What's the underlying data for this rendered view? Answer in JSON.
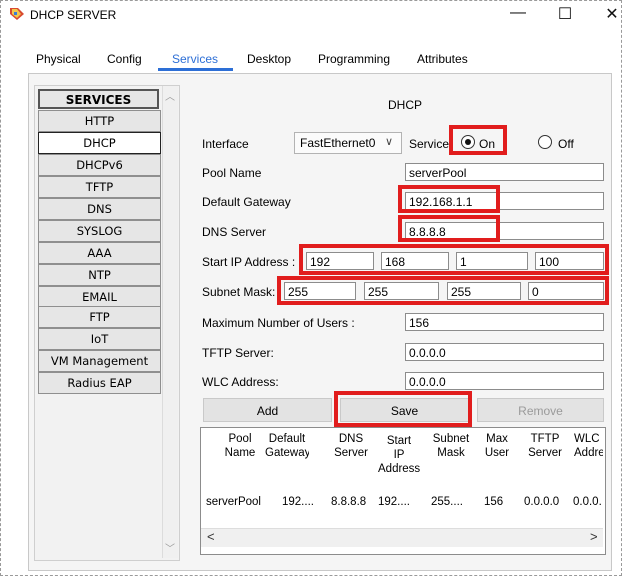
{
  "window": {
    "title": "DHCP SERVER",
    "minimize": "—",
    "maximize": "☐",
    "close": "✕"
  },
  "tabs": [
    "Physical",
    "Config",
    "Services",
    "Desktop",
    "Programming",
    "Attributes"
  ],
  "sidebar": {
    "header": "SERVICES",
    "items": [
      "HTTP",
      "DHCP",
      "DHCPv6",
      "TFTP",
      "DNS",
      "SYSLOG",
      "AAA",
      "NTP",
      "EMAIL",
      "FTP",
      "IoT",
      "VM Management",
      "Radius EAP"
    ],
    "selected": "DHCP"
  },
  "dhcp": {
    "title": "DHCP",
    "interface_label": "Interface",
    "interface_value": "FastEthernet0",
    "service_label": "Service",
    "on_label": "On",
    "off_label": "Off",
    "pool_name_label": "Pool Name",
    "pool_name_value": "serverPool",
    "gateway_label": "Default Gateway",
    "gateway_value": "192.168.1.1",
    "dns_label": "DNS Server",
    "dns_value": "8.8.8.8",
    "start_ip_label": "Start IP Address :",
    "start_ip": [
      "192",
      "168",
      "1",
      "100"
    ],
    "subnet_label": "Subnet Mask:",
    "subnet": [
      "255",
      "255",
      "255",
      "0"
    ],
    "max_users_label": "Maximum Number of Users :",
    "max_users_value": "156",
    "tftp_label": "TFTP Server:",
    "tftp_value": "0.0.0.0",
    "wlc_label": "WLC Address:",
    "wlc_value": "0.0.0.0",
    "add_label": "Add",
    "save_label": "Save",
    "remove_label": "Remove"
  },
  "table": {
    "headers": [
      [
        "Pool",
        "Name"
      ],
      [
        "Default",
        "Gateway"
      ],
      [
        "DNS",
        "Server"
      ],
      [
        "Start",
        "IP",
        "Address"
      ],
      [
        "Subnet",
        "Mask"
      ],
      [
        "Max",
        "User"
      ],
      [
        "TFTP",
        "Server"
      ],
      [
        "WLC",
        "Address"
      ]
    ],
    "rows": [
      [
        "serverPool",
        "192....",
        "8.8.8.8",
        "192....",
        "255....",
        "156",
        "0.0.0.0",
        "0.0.0."
      ]
    ],
    "scroll_left": "<",
    "scroll_right": ">"
  },
  "colors": {
    "active_tab": "#2d6fd6",
    "highlight": "#e11d1d"
  }
}
